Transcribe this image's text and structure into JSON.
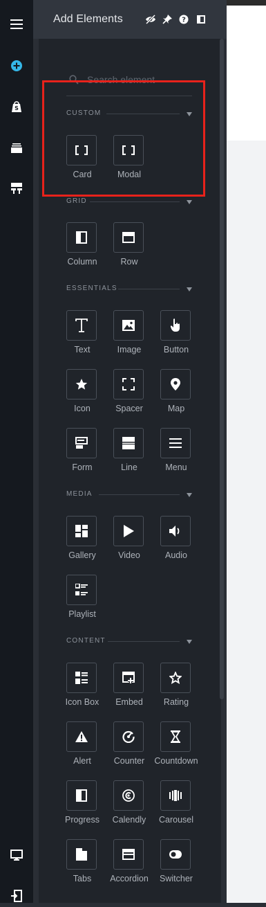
{
  "panel": {
    "title": "Add Elements"
  },
  "header_icons": [
    "eye-slash-icon",
    "pin-icon",
    "help-icon",
    "panel-toggle-icon"
  ],
  "rail_icons": [
    "menu-icon",
    "add-circle-icon",
    "shop-bag-icon",
    "layers-icon",
    "layout-icon",
    "monitor-icon",
    "exit-icon"
  ],
  "search": {
    "placeholder": "Search element",
    "value": ""
  },
  "sections": [
    {
      "id": "custom",
      "label": "CUSTOM",
      "items": [
        {
          "label": "Card",
          "icon": "brackets-icon"
        },
        {
          "label": "Modal",
          "icon": "brackets-icon"
        }
      ]
    },
    {
      "id": "grid",
      "label": "GRID",
      "items": [
        {
          "label": "Column",
          "icon": "column-icon"
        },
        {
          "label": "Row",
          "icon": "row-icon"
        }
      ]
    },
    {
      "id": "essentials",
      "label": "ESSENTIALS",
      "items": [
        {
          "label": "Text",
          "icon": "text-icon"
        },
        {
          "label": "Image",
          "icon": "image-icon"
        },
        {
          "label": "Button",
          "icon": "pointer-hand-icon"
        },
        {
          "label": "Icon",
          "icon": "star-icon"
        },
        {
          "label": "Spacer",
          "icon": "spacer-icon"
        },
        {
          "label": "Map",
          "icon": "map-pin-icon"
        },
        {
          "label": "Form",
          "icon": "form-icon"
        },
        {
          "label": "Line",
          "icon": "line-icon"
        },
        {
          "label": "Menu",
          "icon": "hamburger-icon"
        }
      ]
    },
    {
      "id": "media",
      "label": "MEDIA",
      "items": [
        {
          "label": "Gallery",
          "icon": "gallery-icon"
        },
        {
          "label": "Video",
          "icon": "play-icon"
        },
        {
          "label": "Audio",
          "icon": "speaker-icon"
        },
        {
          "label": "Playlist",
          "icon": "playlist-icon"
        }
      ]
    },
    {
      "id": "content",
      "label": "CONTENT",
      "items": [
        {
          "label": "Icon Box",
          "icon": "icon-box-icon"
        },
        {
          "label": "Embed",
          "icon": "embed-icon"
        },
        {
          "label": "Rating",
          "icon": "star-outline-icon"
        },
        {
          "label": "Alert",
          "icon": "alert-triangle-icon"
        },
        {
          "label": "Counter",
          "icon": "counter-icon"
        },
        {
          "label": "Countdown",
          "icon": "hourglass-icon"
        },
        {
          "label": "Progress",
          "icon": "progress-icon"
        },
        {
          "label": "Calendly",
          "icon": "calendly-icon"
        },
        {
          "label": "Carousel",
          "icon": "carousel-icon"
        },
        {
          "label": "Tabs",
          "icon": "tabs-icon"
        },
        {
          "label": "Accordion",
          "icon": "accordion-icon"
        },
        {
          "label": "Switcher",
          "icon": "switcher-icon"
        }
      ]
    }
  ],
  "colors": {
    "highlight": "#e8221b",
    "accent": "#35b7e8",
    "panel": "#20242a",
    "rail": "#15191f"
  }
}
